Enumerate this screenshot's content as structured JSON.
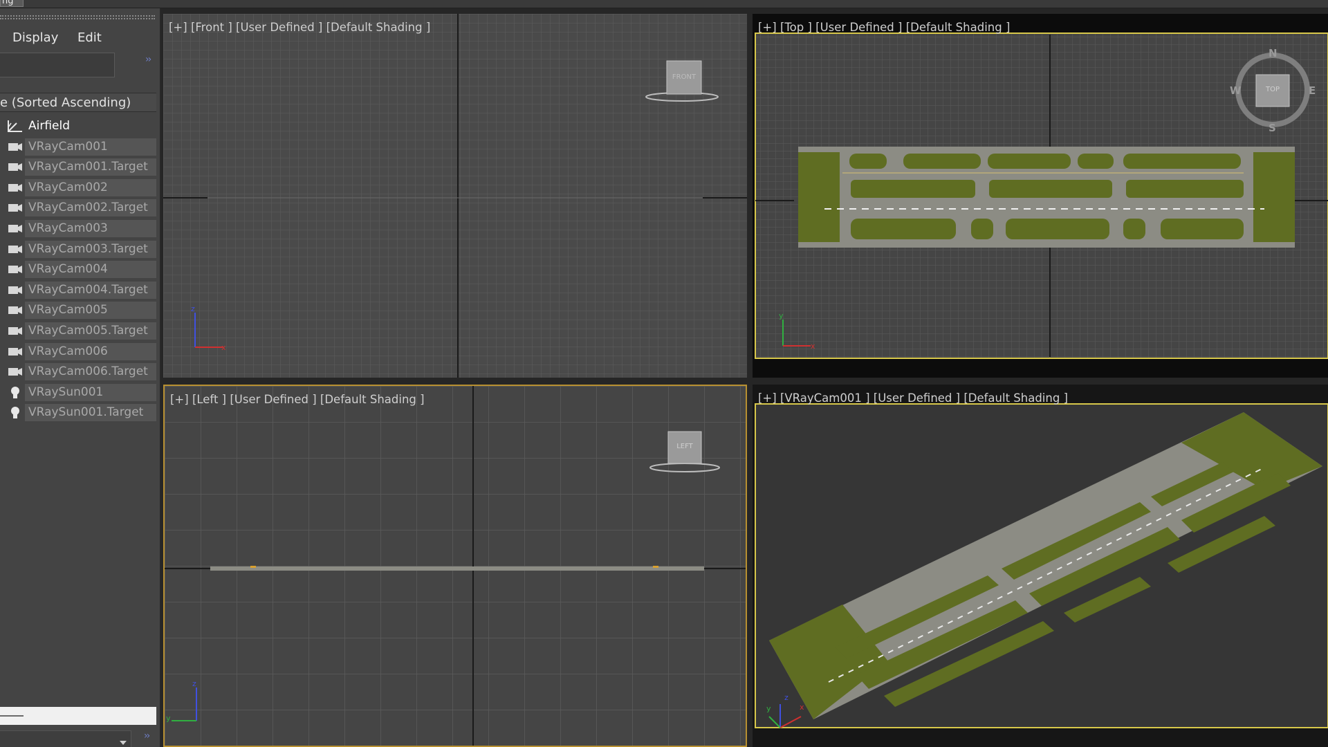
{
  "app": {
    "top_tab_fragment": "ng"
  },
  "explorer": {
    "menu": {
      "display": "Display",
      "edit": "Edit"
    },
    "column_header": "e (Sorted Ascending)",
    "items": [
      {
        "label": "Airfield",
        "icon": "shape-icon"
      },
      {
        "label": "VRayCam001",
        "icon": "camera-icon"
      },
      {
        "label": "VRayCam001.Target",
        "icon": "camera-icon"
      },
      {
        "label": "VRayCam002",
        "icon": "camera-icon"
      },
      {
        "label": "VRayCam002.Target",
        "icon": "camera-icon"
      },
      {
        "label": "VRayCam003",
        "icon": "camera-icon"
      },
      {
        "label": "VRayCam003.Target",
        "icon": "camera-icon"
      },
      {
        "label": "VRayCam004",
        "icon": "camera-icon"
      },
      {
        "label": "VRayCam004.Target",
        "icon": "camera-icon"
      },
      {
        "label": "VRayCam005",
        "icon": "camera-icon"
      },
      {
        "label": "VRayCam005.Target",
        "icon": "camera-icon"
      },
      {
        "label": "VRayCam006",
        "icon": "camera-icon"
      },
      {
        "label": "VRayCam006.Target",
        "icon": "camera-icon"
      },
      {
        "label": "VRaySun001",
        "icon": "light-bulb-icon"
      },
      {
        "label": "VRaySun001.Target",
        "icon": "light-bulb-icon"
      }
    ]
  },
  "viewports": {
    "front": {
      "label": "[+] [Front ] [User Defined ] [Default Shading ]",
      "cube": "FRONT"
    },
    "top": {
      "label": "[+] [Top ] [User Defined ] [Default Shading ]",
      "cube": "TOP",
      "compass": {
        "n": "N",
        "s": "S",
        "e": "E",
        "w": "W"
      }
    },
    "left": {
      "label": "[+] [Left ] [User Defined ] [Default Shading ]",
      "cube": "LEFT"
    },
    "camera": {
      "label": "[+] [VRayCam001 ] [User Defined ] [Default Shading ]"
    }
  },
  "axes": {
    "x": "x",
    "y": "y",
    "z": "z"
  },
  "colors": {
    "grass": "#5f6d22",
    "tarmac": "#8c8c84",
    "active_border": "#b89030",
    "selection_border": "#d8c84a",
    "axis_x": "#d03030",
    "axis_y": "#30b040",
    "axis_z": "#4050e0"
  }
}
